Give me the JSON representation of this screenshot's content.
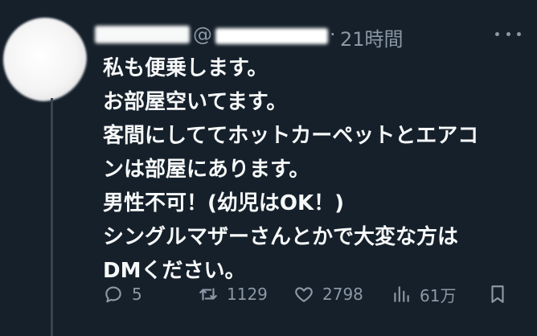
{
  "tweet": {
    "handle_prefix": "@",
    "separator": "·",
    "time": "21時間",
    "lines": [
      "私も便乗します。",
      "お部屋空いてます。",
      "客間にしててホットカーペットとエアコ",
      "ンは部屋にあります。",
      "男性不可！(幼児はOK！)",
      "シングルマザーさんとかで大変な方は",
      "DMください。"
    ]
  },
  "actions": {
    "replies": "5",
    "retweets": "1129",
    "likes": "2798",
    "views": "61万"
  },
  "icons": {
    "reply": "reply-icon",
    "retweet": "retweet-icon",
    "like": "heart-icon",
    "views": "views-icon",
    "bookmark": "bookmark-icon",
    "more": "more-icon"
  },
  "colors": {
    "background": "#15202b",
    "text": "#f7f9f9",
    "secondary": "#8b98a5",
    "thread_line": "#38444d"
  }
}
